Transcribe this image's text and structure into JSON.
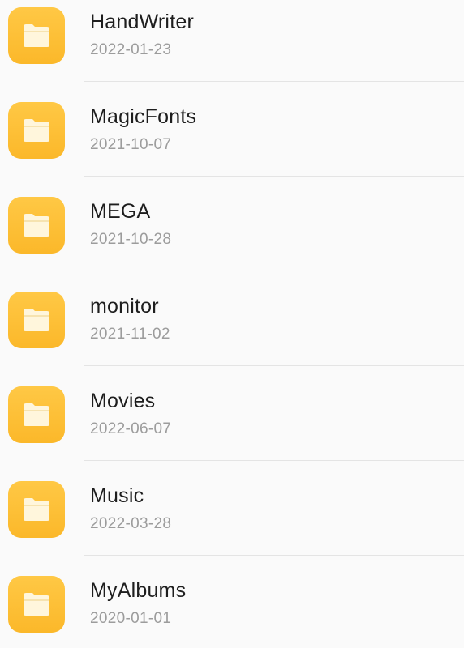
{
  "folders": [
    {
      "name": "HandWriter",
      "date": "2022-01-23",
      "icon": "folder-icon"
    },
    {
      "name": "MagicFonts",
      "date": "2021-10-07",
      "icon": "folder-icon"
    },
    {
      "name": "MEGA",
      "date": "2021-10-28",
      "icon": "folder-icon"
    },
    {
      "name": "monitor",
      "date": "2021-11-02",
      "icon": "folder-icon"
    },
    {
      "name": "Movies",
      "date": "2022-06-07",
      "icon": "folder-icon"
    },
    {
      "name": "Music",
      "date": "2022-03-28",
      "icon": "folder-icon"
    },
    {
      "name": "MyAlbums",
      "date": "2020-01-01",
      "icon": "folder-icon"
    }
  ],
  "colors": {
    "folder_tile": "#fbbd33",
    "folder_glyph": "#fff6dc",
    "name_text": "#1e1e1e",
    "date_text": "#9c9c9c",
    "divider": "#e4e4e4",
    "background": "#fafafa"
  }
}
